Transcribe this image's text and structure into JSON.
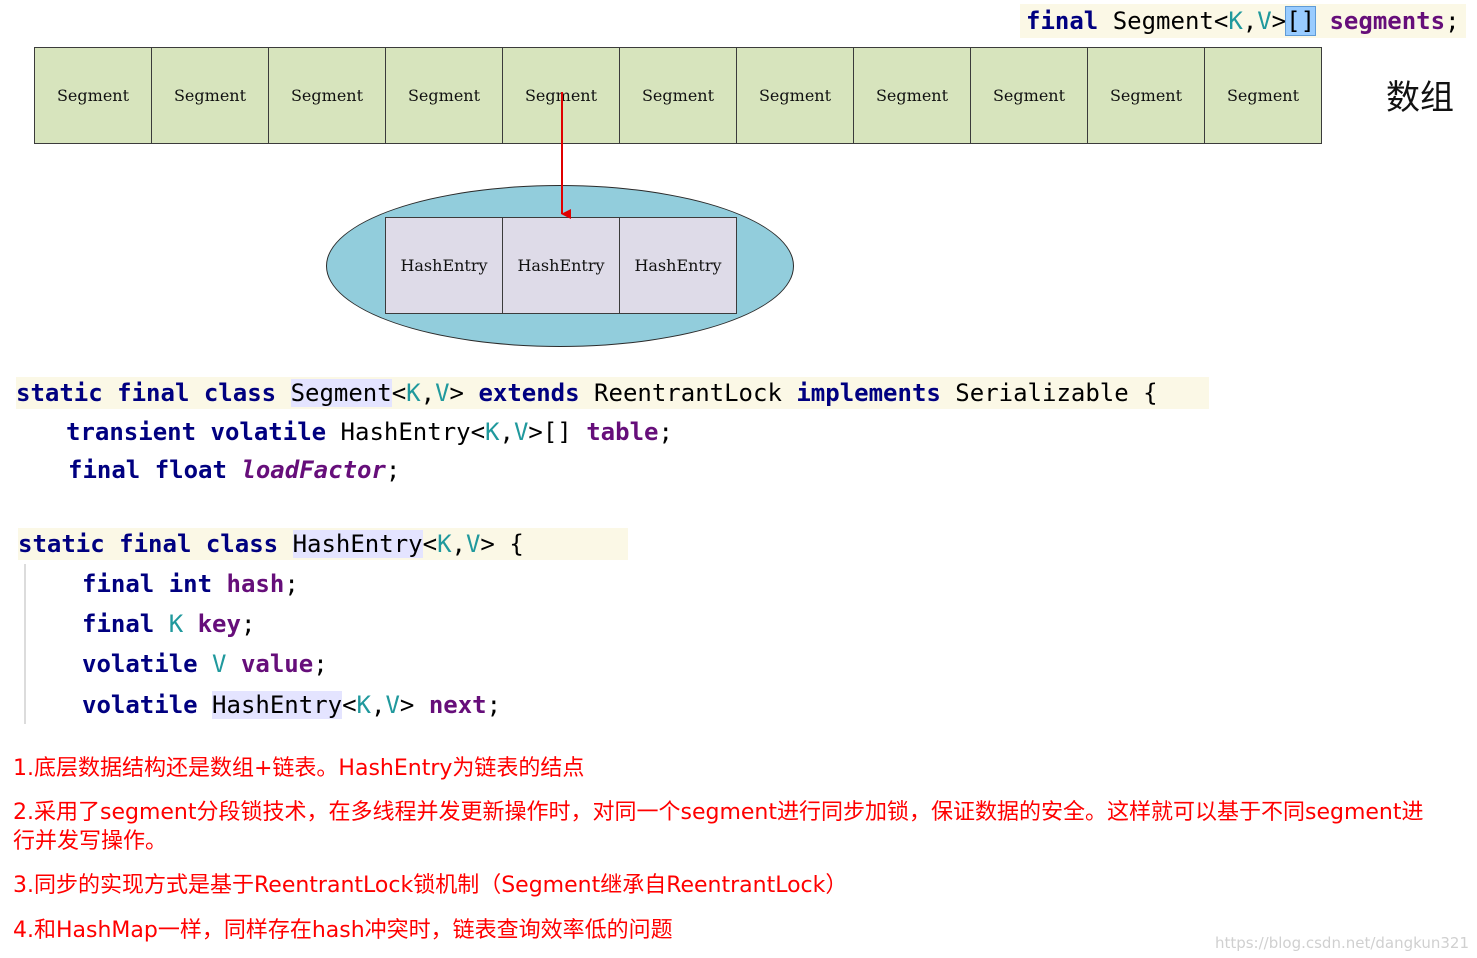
{
  "top_declaration": {
    "kw_final": "final",
    "type_name": "Segment",
    "lt": "<",
    "tp_k": "K",
    "comma": ",",
    "tp_v": "V",
    "gt": ">",
    "brackets": "[]",
    "field": "segments",
    "semicolon": ";"
  },
  "segment_array": {
    "cells": [
      "Segment",
      "Segment",
      "Segment",
      "Segment",
      "Segment",
      "Segment",
      "Segment",
      "Segment",
      "Segment",
      "Segment",
      "Segment"
    ],
    "label": "数组"
  },
  "hashentry_bucket": {
    "cells": [
      "HashEntry",
      "HashEntry",
      "HashEntry"
    ]
  },
  "segment_class": {
    "line1": {
      "static": "static",
      "final": "final",
      "class": "class",
      "name": "Segment",
      "lt": "<",
      "k": "K",
      "comma": ",",
      "v": "V",
      "gt": ">",
      "extends": "extends",
      "parent": "ReentrantLock",
      "implements": "implements",
      "iface": "Serializable",
      "brace": "{"
    },
    "line2": {
      "transient": "transient",
      "volatile": "volatile",
      "type": "HashEntry",
      "lt": "<",
      "k": "K",
      "comma": ",",
      "v": "V",
      "gt": ">[]",
      "field": "table",
      "semi": ";"
    },
    "line3": {
      "final": "final",
      "float": "float",
      "field": "loadFactor",
      "semi": ";"
    }
  },
  "hashentry_class": {
    "line1": {
      "static": "static",
      "final": "final",
      "class": "class",
      "name": "HashEntry",
      "lt": "<",
      "k": "K",
      "comma": ",",
      "v": "V",
      "gt": ">",
      "brace": "{"
    },
    "line2": {
      "final": "final",
      "int": "int",
      "field": "hash",
      "semi": ";"
    },
    "line3": {
      "final": "final",
      "type": "K",
      "field": "key",
      "semi": ";"
    },
    "line4": {
      "volatile": "volatile",
      "type": "V",
      "field": "value",
      "semi": ";"
    },
    "line5": {
      "volatile": "volatile",
      "type": "HashEntry",
      "lt": "<",
      "k": "K",
      "comma": ",",
      "v": "V",
      "gt": ">",
      "field": "next",
      "semi": ";"
    }
  },
  "notes": [
    "1.底层数据结构还是数组+链表。HashEntry为链表的结点",
    "2.采用了segment分段锁技术，在多线程并发更新操作时，对同一个segment进行同步加锁，保证数据的安全。这样就可以基于不同segment进行并发写操作。",
    "3.同步的实现方式是基于ReentrantLock锁机制（Segment继承自ReentrantLock）",
    "4.和HashMap一样，同样存在hash冲突时，链表查询效率低的问题"
  ],
  "watermark": "https://blog.csdn.net/dangkun321",
  "colors": {
    "segment_fill": "#d7e4bd",
    "hashentry_fill": "#dedbe8",
    "ellipse_fill": "#92cddc",
    "arrow": "#e00000",
    "note_text": "#ff0000"
  }
}
